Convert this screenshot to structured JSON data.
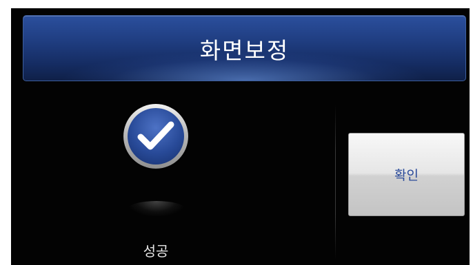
{
  "header": {
    "title": "화면보정"
  },
  "status": {
    "icon": "checkmark-icon",
    "label": "성공"
  },
  "actions": {
    "confirm_label": "확인"
  },
  "colors": {
    "title_bar": "#1f3d80",
    "screen_background": "#030303",
    "button_text": "#2a4a9a",
    "check_circle": "#284a98"
  }
}
